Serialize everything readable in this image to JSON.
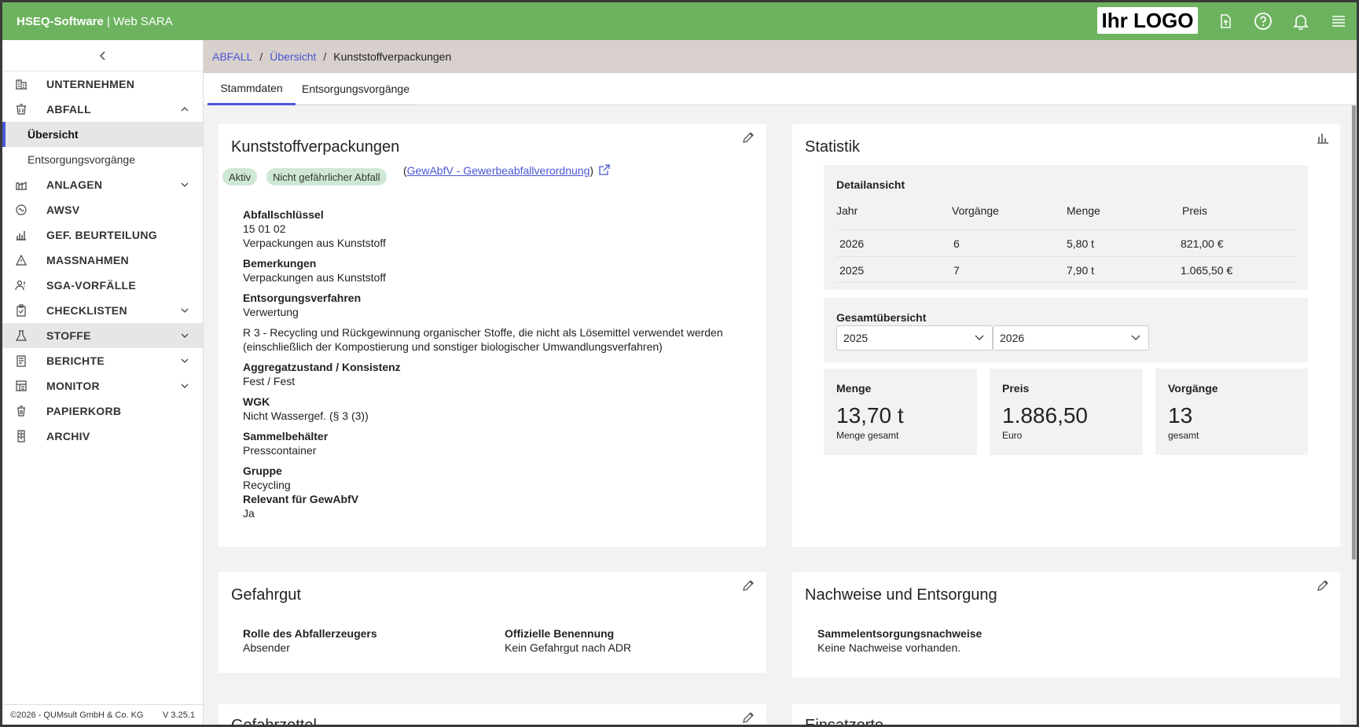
{
  "app": {
    "brand_bold": "HSEQ-Software",
    "brand_sep": " | ",
    "brand_rest": "Web SARA",
    "logo_text": "Ihr LOGO"
  },
  "colors": {
    "topbar": "#6db35f",
    "accent": "#4a56d6",
    "badge": "#cfe8d6",
    "breadbar": "#d8d0cc"
  },
  "topbar_icons": [
    "upload-icon",
    "help-icon",
    "bell-icon",
    "menu-icon"
  ],
  "sidebar": {
    "items": [
      {
        "label": "UNTERNEHMEN",
        "icon": "company-icon"
      },
      {
        "label": "ABFALL",
        "icon": "waste-icon",
        "expanded": true,
        "subitems": [
          {
            "label": "Übersicht",
            "active": true
          },
          {
            "label": "Entsorgungsvorgänge"
          }
        ]
      },
      {
        "label": "ANLAGEN",
        "icon": "plant-icon",
        "expandable": true
      },
      {
        "label": "AWSV",
        "icon": "awsv-icon"
      },
      {
        "label": "GEF. BEURTEILUNG",
        "icon": "assessment-icon"
      },
      {
        "label": "MASSNAHMEN",
        "icon": "measures-icon"
      },
      {
        "label": "SGA-VORFÄLLE",
        "icon": "incidents-icon"
      },
      {
        "label": "CHECKLISTEN",
        "icon": "checklist-icon",
        "expandable": true
      },
      {
        "label": "STOFFE",
        "icon": "flask-icon",
        "expandable": true
      },
      {
        "label": "BERICHTE",
        "icon": "report-icon",
        "expandable": true
      },
      {
        "label": "MONITOR",
        "icon": "monitor-icon",
        "expandable": true
      },
      {
        "label": "PAPIERKORB",
        "icon": "trash-icon"
      },
      {
        "label": "ARCHIV",
        "icon": "archive-icon"
      }
    ],
    "footer_copyright": "©2026 - QUMsult GmbH & Co. KG",
    "footer_version": "V 3.25.1"
  },
  "breadcrumb": {
    "items": [
      "ABFALL",
      "Übersicht"
    ],
    "current": "Kunststoffverpackungen"
  },
  "tabs": [
    "Stammdaten",
    "Entsorgungsvorgänge"
  ],
  "master": {
    "title": "Kunststoffverpackungen",
    "badges": [
      "Aktiv",
      "Nicht gefährlicher Abfall"
    ],
    "link_open": "(",
    "link_text": "GewAbfV - Gewerbeabfallverordnung",
    "link_close": ")",
    "f1_label": "Abfallschlüssel",
    "f1_value1": "15 01 02",
    "f1_value2": "Verpackungen aus Kunststoff",
    "f2_label": "Bemerkungen",
    "f2_value": "Verpackungen aus Kunststoff",
    "f3_label": "Entsorgungsverfahren",
    "f3_value": "Verwertung",
    "f3_text1": "R 3 - Recycling und Rückgewinnung organischer Stoffe, die nicht als Lösemittel verwendet werden",
    "f3_text2": "(einschließlich der Kompostierung und sonstiger biologischer Umwandlungsverfahren)",
    "f4_label": "Aggregatzustand / Konsistenz",
    "f4_value": "Fest / Fest",
    "f5_label": "WGK",
    "f5_value": "Nicht Wassergef. (§ 3 (3))",
    "f6_label": "Sammelbehälter",
    "f6_value": "Presscontainer",
    "f7_label": "Gruppe",
    "f7_value": "Recycling",
    "f8_label": "Relevant für GewAbfV",
    "f8_value": "Ja"
  },
  "statistik": {
    "title": "Statistik",
    "detail_title": "Detailansicht",
    "headers": [
      "Jahr",
      "Vorgänge",
      "Menge",
      "Preis"
    ],
    "rows": [
      [
        "2026",
        "6",
        "5,80 t",
        "821,00 €"
      ],
      [
        "2025",
        "7",
        "7,90 t",
        "1.065,50 €"
      ]
    ],
    "overview_title": "Gesamtübersicht",
    "select_from": "2025",
    "select_to": "2026",
    "kpi1_label": "Menge",
    "kpi1_value": "13,70 t",
    "kpi1_sub": "Menge gesamt",
    "kpi2_label": "Preis",
    "kpi2_value": "1.886,50",
    "kpi2_sub": "Euro",
    "kpi3_label": "Vorgänge",
    "kpi3_value": "13",
    "kpi3_sub": "gesamt"
  },
  "gefahrgut": {
    "title": "Gefahrgut",
    "rolle_label": "Rolle des Abfallerzeugers",
    "rolle_value": "Absender",
    "benennung_label": "Offizielle Benennung",
    "benennung_value": "Kein Gefahrgut nach ADR"
  },
  "nachweise": {
    "title": "Nachweise und Entsorgung",
    "label": "Sammelentsorgungsnachweise",
    "value": "Keine Nachweise vorhanden."
  },
  "gefahrzettel": {
    "title": "Gefahrzettel"
  },
  "einsatzorte": {
    "title": "Einsatzorte"
  }
}
